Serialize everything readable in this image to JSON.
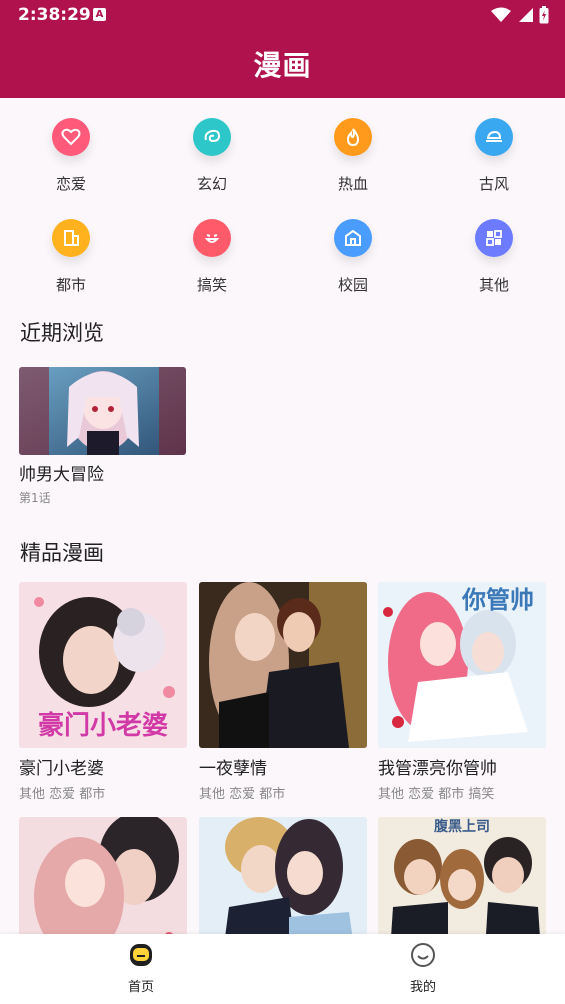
{
  "status": {
    "time": "2:38:29",
    "a_icon": "A"
  },
  "header": {
    "title": "漫画"
  },
  "categories": [
    {
      "label": "恋爱",
      "icon": "heart-icon",
      "color": "#ff5a7a"
    },
    {
      "label": "玄幻",
      "icon": "swirl-icon",
      "color": "#2dc6c9"
    },
    {
      "label": "热血",
      "icon": "flame-icon",
      "color": "#ff9a1c"
    },
    {
      "label": "古风",
      "icon": "cloud-icon",
      "color": "#3aa8f0"
    },
    {
      "label": "都市",
      "icon": "building-icon",
      "color": "#ffb21e"
    },
    {
      "label": "搞笑",
      "icon": "laugh-icon",
      "color": "#ff5a6a"
    },
    {
      "label": "校园",
      "icon": "school-icon",
      "color": "#4a9cff"
    },
    {
      "label": "其他",
      "icon": "grid-icon",
      "color": "#6c7bff"
    }
  ],
  "recent": {
    "title": "近期浏览",
    "items": [
      {
        "name": "帅男大冒险",
        "sub": "第1话"
      }
    ]
  },
  "featured": {
    "title": "精品漫画",
    "items": [
      {
        "name": "豪门小老婆",
        "tags": "其他 恋爱 都市"
      },
      {
        "name": "一夜孽情",
        "tags": "其他 恋爱 都市"
      },
      {
        "name": "我管漂亮你管帅",
        "tags": "其他 恋爱 都市 搞笑"
      },
      {
        "name": "",
        "tags": ""
      },
      {
        "name": "",
        "tags": ""
      },
      {
        "name": "",
        "tags": ""
      }
    ],
    "cover_texts": [
      "豪门小老婆",
      "",
      "你管帅",
      "",
      "",
      "腹黑上司"
    ]
  },
  "bottom_nav": [
    {
      "label": "首页",
      "icon": "home-face-icon",
      "active": true
    },
    {
      "label": "我的",
      "icon": "smile-icon",
      "active": false
    }
  ],
  "colors": {
    "brand": "#b0124e",
    "background": "#fbf7fb"
  }
}
